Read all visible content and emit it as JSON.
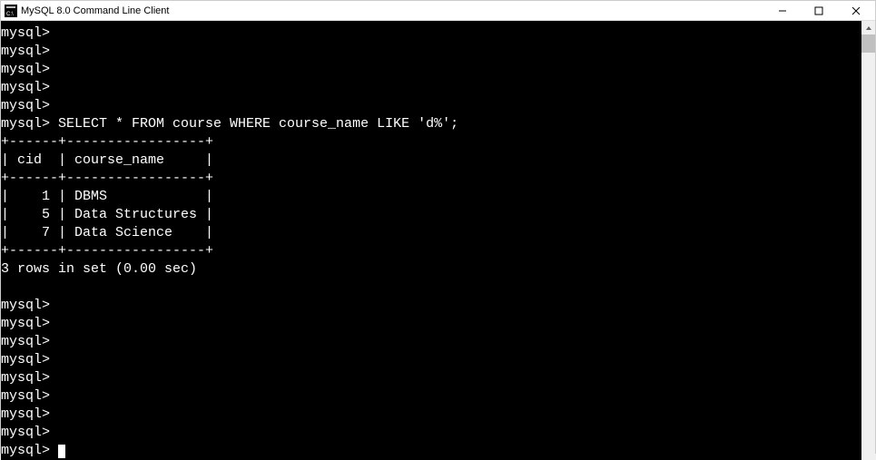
{
  "window": {
    "title": "MySQL 8.0 Command Line Client"
  },
  "terminal": {
    "prompt": "mysql>",
    "empty_prompts_before": 5,
    "query": "SELECT * FROM course WHERE course_name LIKE 'd%';",
    "table": {
      "border_top": "+------+-----------------+",
      "header": "| cid  | course_name     |",
      "border_mid": "+------+-----------------+",
      "rows": [
        "|    1 | DBMS            |",
        "|    5 | Data Structures |",
        "|    7 | Data Science    |"
      ],
      "border_bot": "+------+-----------------+"
    },
    "result_summary": "3 rows in set (0.00 sec)",
    "empty_prompts_after": 9
  },
  "chart_data": {
    "type": "table",
    "title": "course",
    "columns": [
      "cid",
      "course_name"
    ],
    "rows": [
      [
        1,
        "DBMS"
      ],
      [
        5,
        "Data Structures"
      ],
      [
        7,
        "Data Science"
      ]
    ],
    "query": "SELECT * FROM course WHERE course_name LIKE 'd%';",
    "rows_in_set": 3,
    "elapsed_sec": 0.0
  }
}
